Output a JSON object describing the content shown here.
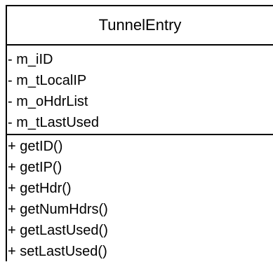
{
  "class_box": {
    "title": "TunnelEntry",
    "attributes": [
      "- m_iID",
      "- m_tLocalIP",
      "- m_oHdrList",
      "- m_tLastUsed"
    ],
    "methods": [
      "+ getID()",
      "+ getIP()",
      "+ getHdr()",
      "+ getNumHdrs()",
      "+ getLastUsed()",
      "+ setLastUsed()"
    ]
  }
}
